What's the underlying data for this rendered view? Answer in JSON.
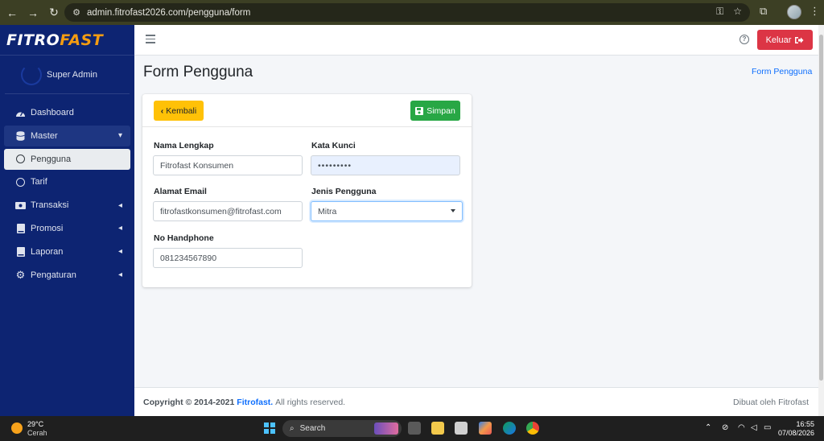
{
  "browser": {
    "url": "admin.fitrofast2026.com/pengguna/form"
  },
  "brand": {
    "part1": "FITRO",
    "part2": "FAST"
  },
  "user": {
    "name": "Super Admin"
  },
  "sidebar": {
    "items": [
      {
        "label": "Dashboard"
      },
      {
        "label": "Master"
      },
      {
        "label": "Pengguna"
      },
      {
        "label": "Tarif"
      },
      {
        "label": "Transaksi"
      },
      {
        "label": "Promosi"
      },
      {
        "label": "Laporan"
      },
      {
        "label": "Pengaturan"
      }
    ]
  },
  "header": {
    "logout_label": "Keluar"
  },
  "page": {
    "title": "Form Pengguna",
    "breadcrumb": "Form Pengguna"
  },
  "form": {
    "back_label": "Kembali",
    "save_label": "Simpan",
    "full_name": {
      "label": "Nama Lengkap",
      "value": "Fitrofast Konsumen"
    },
    "password": {
      "label": "Kata Kunci",
      "value": "•••••••••"
    },
    "email": {
      "label": "Alamat Email",
      "value": "fitrofastkonsumen@fitrofast.com"
    },
    "user_type": {
      "label": "Jenis Pengguna",
      "value": "Mitra"
    },
    "phone": {
      "label": "No Handphone",
      "value": "081234567890"
    }
  },
  "footer": {
    "copyright_prefix": "Copyright © 2014-2021",
    "company": "Fitrofast.",
    "rights": "All rights reserved.",
    "credit": "Dibuat oleh Fitrofast"
  },
  "taskbar": {
    "temperature": "29°C",
    "weather": "Cerah",
    "search_label": "Search",
    "time": "16:55",
    "date": "07/08/2026"
  },
  "colors": {
    "sidebar_bg": "#0d2472",
    "brand_accent": "#f39c12",
    "logout": "#dc3545",
    "back": "#ffc107",
    "save": "#28a745",
    "link": "#0d6efd"
  }
}
